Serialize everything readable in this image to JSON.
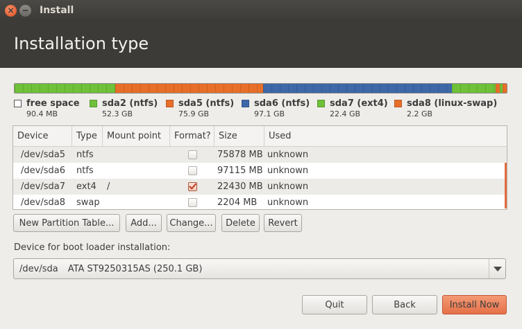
{
  "window": {
    "title": "Install"
  },
  "header": {
    "title": "Installation type"
  },
  "partitions": [
    {
      "name": "free space",
      "size": "90.4 MB",
      "color": "#ffffff",
      "bar_color": "#6fc13a",
      "fraction": 0.2068,
      "is_free": true
    },
    {
      "name": "sda2 (ntfs)",
      "size": "52.3 GB",
      "color": "#6fc13a",
      "bar_color": "#e86f29",
      "fraction": 0.303
    },
    {
      "name": "sda5 (ntfs)",
      "size": "75.9 GB",
      "color": "#e86f29",
      "bar_color": "#3e68a8",
      "fraction": 0.3874
    },
    {
      "name": "sda6 (ntfs)",
      "size": "97.1 GB",
      "color": "#3e68a8",
      "bar_color": "#6fc13a",
      "fraction": 0.0899
    },
    {
      "name": "sda7 (ext4)",
      "size": "22.4 GB",
      "color": "#6fc13a",
      "bar_color": "#e86f29",
      "fraction": 0.0088
    },
    {
      "name": "sda8 (linux-swap)",
      "size": "2.2 GB",
      "color": "#e86f29",
      "bar_color": "#6fc13a",
      "fraction": 0.0056
    },
    {
      "name": "",
      "size": "",
      "color": "",
      "bar_color": "#e86f29",
      "fraction": 0.0085,
      "bar_only": true
    }
  ],
  "table": {
    "headers": {
      "device": "Device",
      "type": "Type",
      "mount": "Mount point",
      "format": "Format?",
      "size": "Size",
      "used": "Used"
    },
    "rows": [
      {
        "device": "/dev/sda5",
        "type": "ntfs",
        "mount": "",
        "format": false,
        "size": "75878 MB",
        "used": "unknown"
      },
      {
        "device": "/dev/sda6",
        "type": "ntfs",
        "mount": "",
        "format": false,
        "size": "97115 MB",
        "used": "unknown"
      },
      {
        "device": "/dev/sda7",
        "type": "ext4",
        "mount": "/",
        "format": true,
        "size": "22430 MB",
        "used": "unknown"
      },
      {
        "device": "/dev/sda8",
        "type": "swap",
        "mount": "",
        "format": false,
        "size": "2204 MB",
        "used": "unknown"
      }
    ]
  },
  "partition_buttons": {
    "new_table": "New Partition Table...",
    "add": "Add...",
    "change": "Change...",
    "delete": "Delete",
    "revert": "Revert"
  },
  "bootloader": {
    "label": "Device for boot loader installation:",
    "device": "/dev/sda",
    "disk": "ATA ST9250315AS (250.1 GB)"
  },
  "footer_buttons": {
    "quit": "Quit",
    "back": "Back",
    "install_now": "Install Now"
  },
  "colors": {
    "accent": "#e16c3d",
    "header_bg": "#3c3b37"
  }
}
